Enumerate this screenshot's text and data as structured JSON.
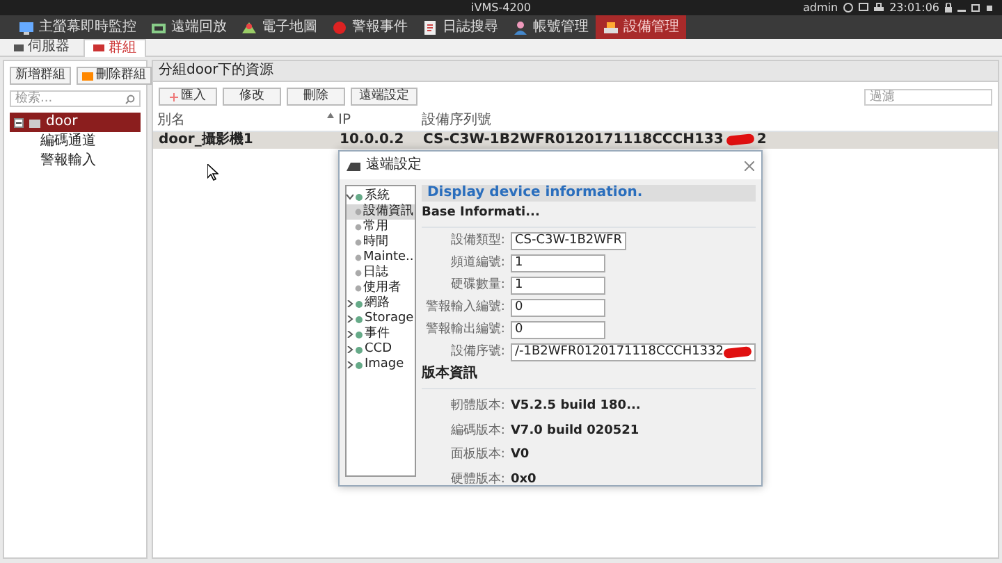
{
  "title_bar": {
    "title": "iVMS-4200",
    "user": "admin",
    "time": "23:01:06"
  },
  "menu": [
    {
      "label": "主螢幕即時監控",
      "selected": false
    },
    {
      "label": "遠端回放",
      "selected": false
    },
    {
      "label": "電子地圖",
      "selected": false
    },
    {
      "label": "警報事件",
      "selected": false
    },
    {
      "label": "日誌搜尋",
      "selected": false
    },
    {
      "label": "帳號管理",
      "selected": false
    },
    {
      "label": "設備管理",
      "selected": true
    }
  ],
  "tabs": [
    {
      "label": "伺服器",
      "selected": false
    },
    {
      "label": "群組",
      "selected": true
    }
  ],
  "group_panel": {
    "buttons": [
      "新增群組",
      "刪除群組"
    ],
    "search": {
      "placeholder": "檢索..."
    },
    "tree": [
      {
        "label": "door",
        "selected": true,
        "expanded": true,
        "children": [
          {
            "label": "編碼通道",
            "selected": false
          },
          {
            "label": "警報輸入",
            "selected": false
          }
        ]
      }
    ]
  },
  "resources": {
    "title": "分組door下的資源",
    "buttons": [
      "匯入",
      "修改",
      "刪除",
      "遠端設定"
    ],
    "filter": {
      "placeholder": "過濾"
    },
    "columns": [
      "別名",
      "IP",
      "設備序列號"
    ],
    "rows": [
      {
        "cells": [
          "door_攝影機1",
          "10.0.0.2",
          "CS-C3W-1B2WFR0120171118CCCH133"
        ],
        "serial_tail": "2",
        "redacted": true,
        "selected": true
      }
    ]
  },
  "dialog": {
    "title": "遠端設定",
    "tree": [
      {
        "label": "系統",
        "expanded": true,
        "children": [
          {
            "label": "設備資訊",
            "selected": true
          },
          {
            "label": "常用",
            "selected": false
          },
          {
            "label": "時間",
            "selected": false
          },
          {
            "label": "Mainte...",
            "selected": false
          },
          {
            "label": "日誌",
            "selected": false
          },
          {
            "label": "使用者",
            "selected": false
          }
        ]
      },
      {
        "label": "網路",
        "expanded": false
      },
      {
        "label": "Storage",
        "expanded": false
      },
      {
        "label": "事件",
        "expanded": false
      },
      {
        "label": "CCD",
        "expanded": false
      },
      {
        "label": "Image",
        "expanded": false
      }
    ],
    "heading": "Display device information.",
    "section": "Base Informati...",
    "fields": [
      {
        "label": "設備類型:",
        "value": "CS-C3W-1B2WFR",
        "redacted": false
      },
      {
        "label": "頻道編號:",
        "value": "1",
        "redacted": false
      },
      {
        "label": "硬碟數量:",
        "value": "1",
        "redacted": false
      },
      {
        "label": "警報輸入編號:",
        "value": "0",
        "redacted": false
      },
      {
        "label": "警報輸出編號:",
        "value": "0",
        "redacted": false
      },
      {
        "label": "設備序號:",
        "value": "/-1B2WFR0120171118CCCH1332",
        "redacted": true
      }
    ],
    "version_title": "版本資訊",
    "versions": [
      {
        "label": "軔體版本:",
        "value": "V5.2.5 build 180..."
      },
      {
        "label": "編碼版本:",
        "value": "V7.0 build 020521"
      },
      {
        "label": "面板版本:",
        "value": "V0"
      },
      {
        "label": "硬體版本:",
        "value": "0x0"
      }
    ]
  }
}
